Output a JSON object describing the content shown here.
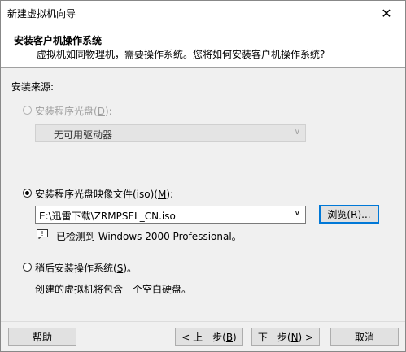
{
  "window": {
    "title": "新建虚拟机向导",
    "close_glyph": "✕"
  },
  "header": {
    "title": "安装客户机操作系统",
    "subtitle": "虚拟机如同物理机，需要操作系统。您将如何安装客户机操作系统?"
  },
  "install_source_label": "安装来源:",
  "options": {
    "disc": {
      "label_pre": "安装程序光盘(",
      "key": "D",
      "label_post": "):",
      "selected": false,
      "enabled": false
    },
    "disc_drive": {
      "value": "无可用驱动器"
    },
    "iso": {
      "label_pre": "安装程序光盘映像文件(iso)(",
      "key": "M",
      "label_post": "):",
      "selected": true,
      "enabled": true
    },
    "iso_path": {
      "value": "E:\\迅雷下载\\ZRMPSEL_CN.iso"
    },
    "browse": {
      "label_pre": "浏览(",
      "key": "R",
      "label_post": ")..."
    },
    "detected": "已检测到 Windows 2000 Professional。",
    "later": {
      "label_pre": "稍后安装操作系统(",
      "key": "S",
      "label_post": ")。",
      "selected": false,
      "enabled": true
    },
    "later_desc": "创建的虚拟机将包含一个空白硬盘。"
  },
  "footer": {
    "help": "帮助",
    "back": {
      "label_pre": "< 上一步(",
      "key": "B",
      "label_post": ")"
    },
    "next": {
      "label_pre": "下一步(",
      "key": "N",
      "label_post": ") >"
    },
    "cancel": "取消"
  }
}
